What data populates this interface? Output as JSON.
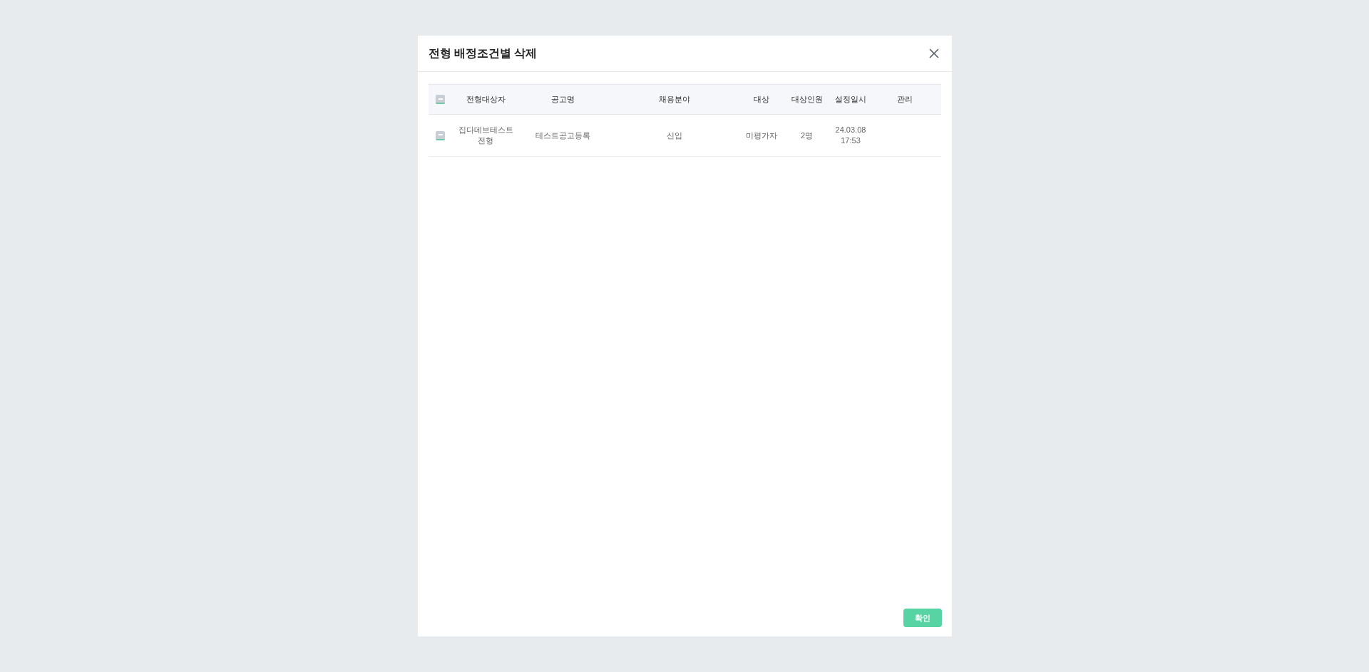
{
  "dialog": {
    "title": "전형 배정조건별 삭제"
  },
  "table": {
    "header_checkbox": {
      "checked": false
    },
    "columns": [
      "전형대상자",
      "공고명",
      "채용분야",
      "대상",
      "대상인원",
      "설정일시",
      "관리"
    ],
    "rows": [
      {
        "checked": false,
        "cells": [
          "집다데브테스트전형",
          "테스트공고등록",
          "신입",
          "미평가자",
          "2명",
          "24.03.08 17:53",
          ""
        ]
      }
    ]
  },
  "buttons": [
    "확인"
  ]
}
